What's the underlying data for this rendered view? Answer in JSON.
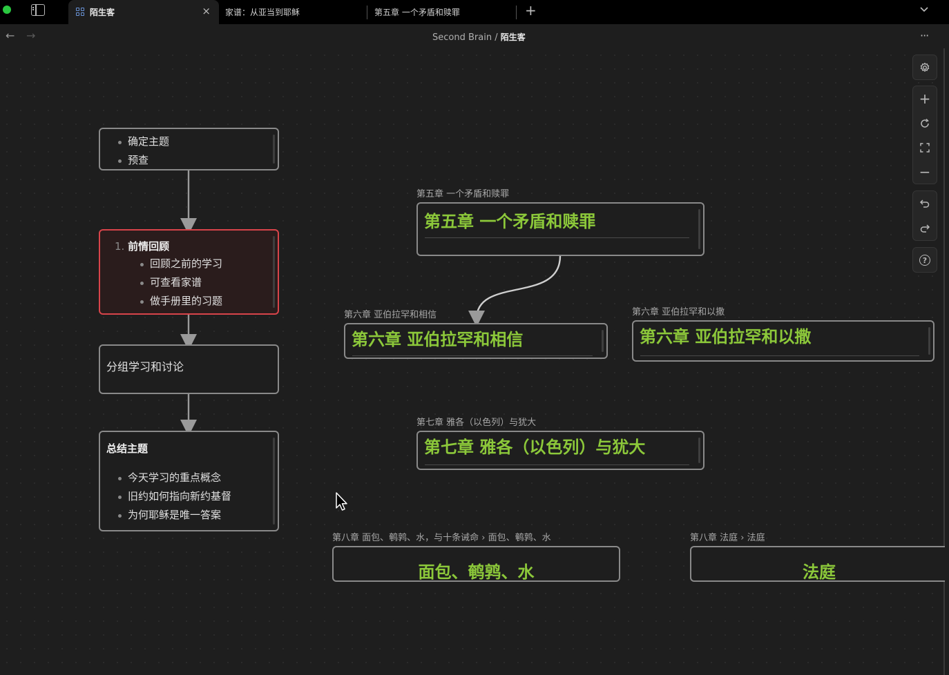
{
  "tabs": {
    "active": {
      "label": "陌生客",
      "close": "×"
    },
    "others": [
      {
        "label": "家谱：从亚当到耶稣"
      },
      {
        "label": "第五章 一个矛盾和赎罪"
      }
    ],
    "new_tab": "+"
  },
  "nav": {
    "back": "←",
    "forward": "→",
    "breadcrumb_root": "Second Brain",
    "breadcrumb_sep": " / ",
    "breadcrumb_current": "陌生客",
    "more": "···"
  },
  "flow": {
    "card1": {
      "items": [
        "确定主题",
        "预查"
      ]
    },
    "card2": {
      "number": "1.",
      "title": "前情回顾",
      "items": [
        "回顾之前的学习",
        "可查看家谱",
        "做手册里的习题"
      ]
    },
    "card3": {
      "text": "分组学习和讨论"
    },
    "card4": {
      "title": "总结主题",
      "items": [
        "今天学习的重点概念",
        "旧约如何指向新约基督",
        "为何耶稣是唯一答案"
      ]
    }
  },
  "notes": {
    "ch5": {
      "label": "第五章 一个矛盾和赎罪",
      "heading": "第五章 一个矛盾和赎罪"
    },
    "ch6a": {
      "label": "第六章 亚伯拉罕和相信",
      "heading": "第六章 亚伯拉罕和相信"
    },
    "ch6b": {
      "label": "第六章 亚伯拉罕和以撒",
      "heading": "第六章 亚伯拉罕和以撒"
    },
    "ch7": {
      "label": "第七章 雅各（以色列）与犹大",
      "heading": "第七章 雅各（以色列）与犹大"
    },
    "ch8a": {
      "label": "第八章 面包、鹌鹑、水，与十条诫命 › 面包、鹌鹑、水",
      "heading": "面包、鹌鹑、水"
    },
    "ch8b": {
      "label": "第八章 法庭 › 法庭",
      "heading": "法庭"
    }
  },
  "toolbar": {
    "settings": "gear-icon",
    "zoom_in": "+",
    "reset": "refresh-icon",
    "fit": "fit-icon",
    "zoom_out": "−",
    "undo": "undo-icon",
    "redo": "redo-icon",
    "help": "?"
  },
  "colors": {
    "heading_green": "#8cc83a",
    "highlight_red": "#d8444a",
    "border_gray": "#8a8a8a"
  }
}
